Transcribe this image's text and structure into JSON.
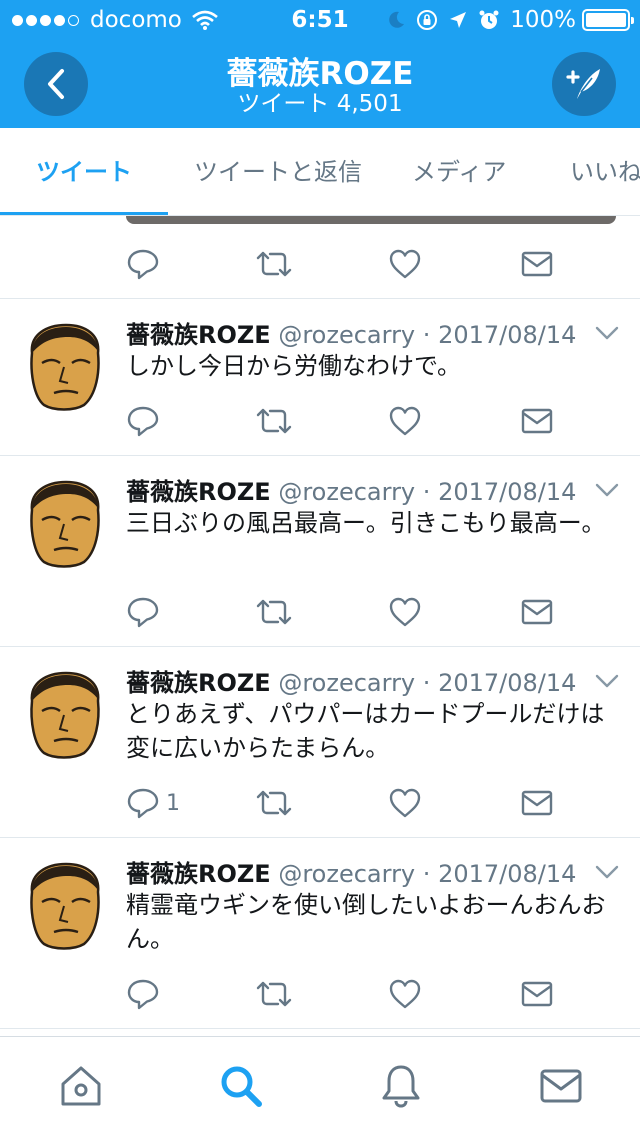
{
  "status_bar": {
    "carrier": "docomo",
    "time": "6:51",
    "battery": "100%"
  },
  "header": {
    "title": "薔薇族ROZE",
    "subtitle": "ツイート 4,501",
    "back_icon": "chevron-left-icon",
    "compose_icon": "compose-tweet-icon"
  },
  "tabs": [
    {
      "label": "ツイート",
      "active": true
    },
    {
      "label": "ツイートと返信",
      "active": false
    },
    {
      "label": "メディア",
      "active": false
    },
    {
      "label": "いいね",
      "active": false
    }
  ],
  "tweets": [
    {
      "name": "薔薇族ROZE",
      "handle": "@rozecarry",
      "separator": "·",
      "date": "2017/08/14",
      "text": "しかし今日から労働なわけで。",
      "reply_count": ""
    },
    {
      "name": "薔薇族ROZE",
      "handle": "@rozecarry",
      "separator": "·",
      "date": "2017/08/14",
      "text": "三日ぶりの風呂最高ー。引きこもり最高ー。",
      "reply_count": ""
    },
    {
      "name": "薔薇族ROZE",
      "handle": "@rozecarry",
      "separator": "·",
      "date": "2017/08/14",
      "text": "とりあえず、パウパーはカードプールだけは変に広いからたまらん。",
      "reply_count": "1"
    },
    {
      "name": "薔薇族ROZE",
      "handle": "@rozecarry",
      "separator": "·",
      "date": "2017/08/14",
      "text": "精霊竜ウギンを使い倒したいよおーんおんおん。",
      "reply_count": ""
    }
  ],
  "bottom_nav": [
    {
      "icon": "home-icon",
      "active": false
    },
    {
      "icon": "search-icon",
      "active": true
    },
    {
      "icon": "notifications-bell-icon",
      "active": false
    },
    {
      "icon": "messages-envelope-icon",
      "active": false
    }
  ],
  "colors": {
    "brand": "#1da1f2",
    "header_button": "#1a77b5",
    "secondary_text": "#657786",
    "divider": "#e1e8ed"
  }
}
